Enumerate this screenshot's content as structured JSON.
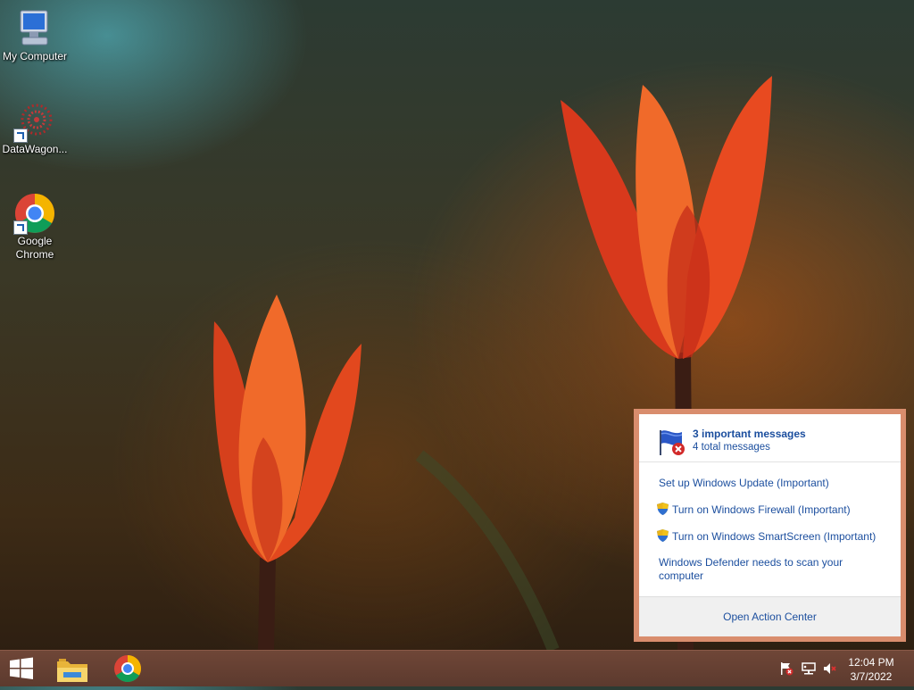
{
  "desktop": {
    "icons": [
      {
        "label": "My Computer",
        "icon": "computer-icon"
      },
      {
        "label": "DataWagon...",
        "icon": "datawagon-icon"
      },
      {
        "label": "Google Chrome",
        "icon": "chrome-icon"
      }
    ]
  },
  "action_center": {
    "title": "3 important messages",
    "subtitle": "4 total messages",
    "items": [
      {
        "text": "Set up Windows Update (Important)",
        "icon": null
      },
      {
        "text": "Turn on Windows Firewall (Important)",
        "icon": "shield-icon"
      },
      {
        "text": "Turn on Windows SmartScreen (Important)",
        "icon": "shield-icon"
      },
      {
        "text": "Windows Defender needs to scan your computer",
        "icon": null
      }
    ],
    "footer": "Open Action Center"
  },
  "taskbar": {
    "pinned": [
      "start-icon",
      "file-explorer-icon",
      "chrome-icon"
    ],
    "tray": [
      "action-center-flag-icon",
      "network-icon",
      "volume-muted-icon"
    ],
    "time": "12:04 PM",
    "date": "3/7/2022"
  },
  "colors": {
    "link": "#1b4e9e",
    "popup_border": "#d98d6d",
    "taskbar": "#5c3a2e"
  }
}
